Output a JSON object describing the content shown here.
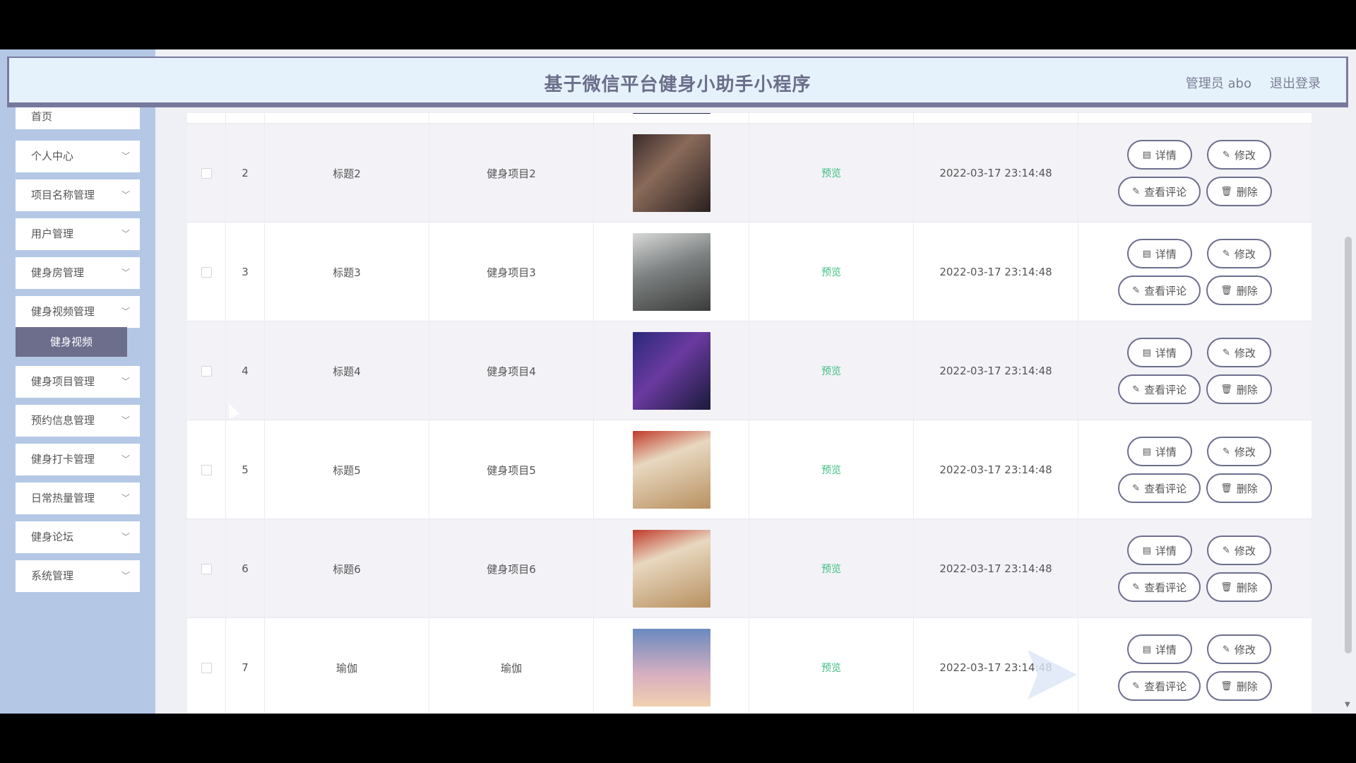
{
  "header": {
    "title": "基于微信平台健身小助手小程序",
    "user": "管理员 abo",
    "logout": "退出登录"
  },
  "sidebar": {
    "items": [
      {
        "label": "首页"
      },
      {
        "label": "个人中心"
      },
      {
        "label": "项目名称管理"
      },
      {
        "label": "用户管理"
      },
      {
        "label": "健身房管理"
      },
      {
        "label": "健身视频管理"
      },
      {
        "label": "健身项目管理"
      },
      {
        "label": "预约信息管理"
      },
      {
        "label": "健身打卡管理"
      },
      {
        "label": "日常热量管理"
      },
      {
        "label": "健身论坛"
      },
      {
        "label": "系统管理"
      }
    ],
    "active_sub": "健身视频"
  },
  "table": {
    "rows": [
      {
        "index": "2",
        "title": "标题2",
        "project": "健身项目2",
        "preview": "预览",
        "time": "2022-03-17 23:14:48"
      },
      {
        "index": "3",
        "title": "标题3",
        "project": "健身项目3",
        "preview": "预览",
        "time": "2022-03-17 23:14:48"
      },
      {
        "index": "4",
        "title": "标题4",
        "project": "健身项目4",
        "preview": "预览",
        "time": "2022-03-17 23:14:48"
      },
      {
        "index": "5",
        "title": "标题5",
        "project": "健身项目5",
        "preview": "预览",
        "time": "2022-03-17 23:14:48"
      },
      {
        "index": "6",
        "title": "标题6",
        "project": "健身项目6",
        "preview": "预览",
        "time": "2022-03-17 23:14:48"
      },
      {
        "index": "7",
        "title": "瑜伽",
        "project": "瑜伽",
        "preview": "预览",
        "time": "2022-03-17 23:14:48"
      }
    ],
    "buttons": {
      "detail": "详情",
      "edit": "修改",
      "comments": "查看评论",
      "delete": "删除"
    }
  },
  "colors": {
    "accent": "#6c6e8c",
    "preview": "#3fbf82",
    "sidebar_bg": "#b4c8e6",
    "header_bg": "#e6f2fb"
  }
}
